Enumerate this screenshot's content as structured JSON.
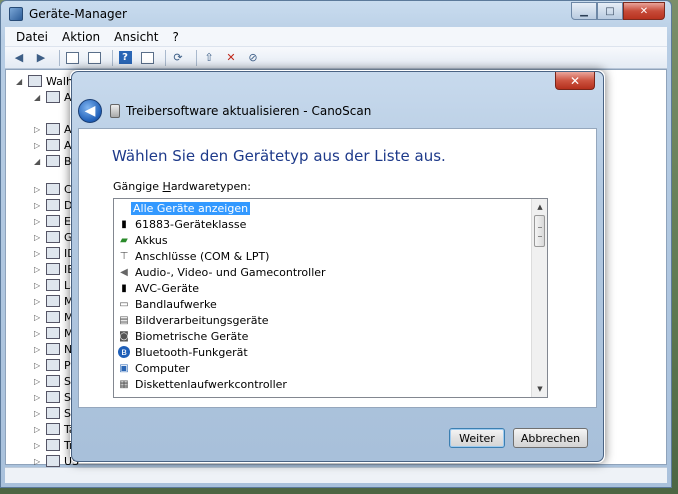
{
  "main_window": {
    "title": "Geräte-Manager",
    "menu": [
      "Datei",
      "Aktion",
      "Ansicht",
      "?"
    ],
    "tree_root": "Walho",
    "tree_visible_prefixes": [
      "A",
      "Ar",
      "A",
      "Bi",
      "Co",
      "DV",
      "Ei",
      "G",
      "ID",
      "IE",
      "La",
      "M",
      "M",
      "M",
      "Ne",
      "Pr",
      "Sn",
      "Sp",
      "Sy",
      "Ta",
      "Tr",
      "US"
    ]
  },
  "dialog": {
    "title": "Treibersoftware aktualisieren - CanoScan",
    "close_symbol": "✕",
    "back_symbol": "◀",
    "heading": "Wählen Sie den Gerätetyp aus der Liste aus.",
    "list_label_prefix": "Gängige ",
    "list_label_accel": "H",
    "list_label_suffix": "ardwaretypen:",
    "items": [
      {
        "label": "Alle Geräte anzeigen",
        "icon": "none",
        "selected": true
      },
      {
        "label": "61883-Geräteklasse",
        "icon": "connector-icon"
      },
      {
        "label": "Akkus",
        "icon": "battery-icon"
      },
      {
        "label": "Anschlüsse (COM & LPT)",
        "icon": "port-icon"
      },
      {
        "label": "Audio-, Video- und Gamecontroller",
        "icon": "speaker-icon"
      },
      {
        "label": "AVC-Geräte",
        "icon": "connector-icon"
      },
      {
        "label": "Bandlaufwerke",
        "icon": "tape-drive-icon"
      },
      {
        "label": "Bildverarbeitungsgeräte",
        "icon": "scanner-icon"
      },
      {
        "label": "Biometrische Geräte",
        "icon": "biometric-icon"
      },
      {
        "label": "Bluetooth-Funkgerät",
        "icon": "bluetooth-icon"
      },
      {
        "label": "Computer",
        "icon": "computer-icon"
      },
      {
        "label": "Diskettenlaufwerkcontroller",
        "icon": "floppy-controller-icon"
      }
    ],
    "next_label": "Weiter",
    "cancel_label": "Abbrechen"
  }
}
